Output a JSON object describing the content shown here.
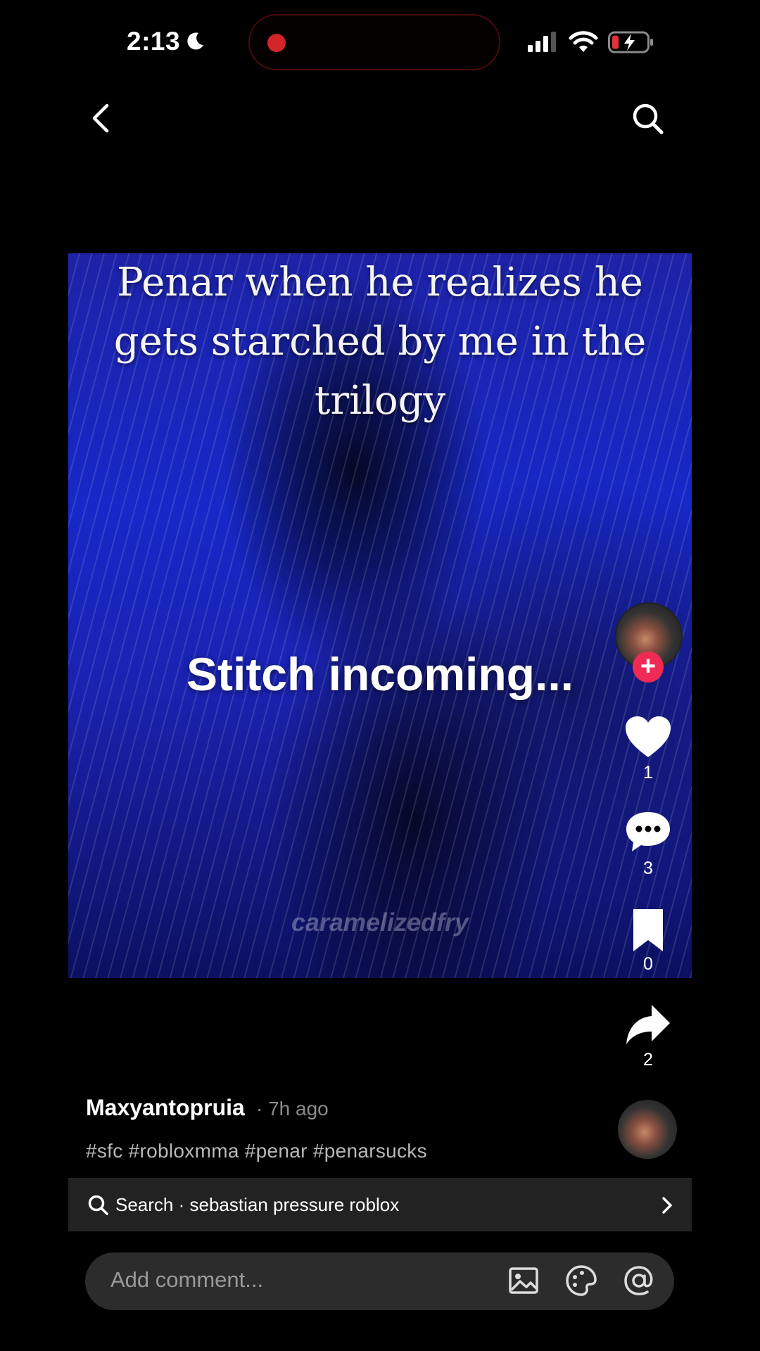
{
  "status_bar": {
    "time": "2:13"
  },
  "video": {
    "caption": "Penar when he realizes he gets starched by me in the trilogy",
    "overlay_text": "Stitch incoming...",
    "watermark": "caramelizedfry"
  },
  "actions": {
    "likes": "1",
    "comments": "3",
    "saves": "0",
    "shares": "2"
  },
  "post": {
    "username": "Maxyantopruia",
    "time_ago": "· 7h ago",
    "hashtags": "#sfc #robloxmma #penar #penarsucks"
  },
  "search_suggestion": {
    "text": "Search · sebastian pressure roblox"
  },
  "comment": {
    "placeholder": "Add comment..."
  },
  "colors": {
    "follow_accent": "#ef2b55",
    "recording_dot": "#d3242a",
    "battery_low": "#e0323a"
  }
}
